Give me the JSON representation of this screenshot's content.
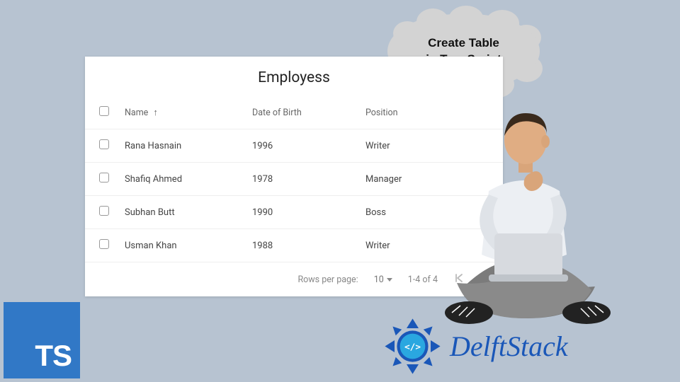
{
  "thought": {
    "line1": "Create Table",
    "line2": "in TypeScript"
  },
  "table": {
    "title": "Employess",
    "columns": {
      "name": "Name",
      "dob": "Date of Birth",
      "position": "Position"
    },
    "sort_col": "name",
    "rows": [
      {
        "name": "Rana Hasnain",
        "dob": "1996",
        "position": "Writer"
      },
      {
        "name": "Shafiq Ahmed",
        "dob": "1978",
        "position": "Manager"
      },
      {
        "name": "Subhan Butt",
        "dob": "1990",
        "position": "Boss"
      },
      {
        "name": "Usman Khan",
        "dob": "1988",
        "position": "Writer"
      }
    ],
    "footer": {
      "rows_label": "Rows per page:",
      "rows_value": "10",
      "range_text": "1-4 of 4"
    }
  },
  "ts_badge": "TS",
  "delft": {
    "text": "DelftStack",
    "code_glyph": "</>"
  }
}
